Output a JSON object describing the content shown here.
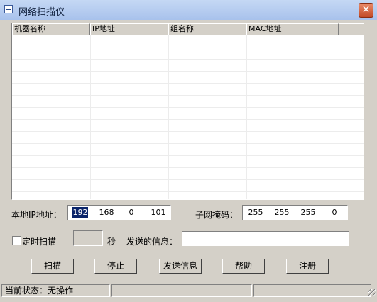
{
  "window": {
    "title": "网络扫描仪",
    "close_glyph": "✕"
  },
  "list": {
    "columns": [
      "机器名称",
      "IP地址",
      "组名称",
      "MAC地址"
    ]
  },
  "local_ip": {
    "label": "本地IP地址：",
    "octets": [
      "192",
      "168",
      "0",
      "101"
    ]
  },
  "subnet": {
    "label": "子网掩码：",
    "octets": [
      "255",
      "255",
      "255",
      "0"
    ]
  },
  "timer": {
    "label": "定时扫描",
    "unit": "秒",
    "value": ""
  },
  "message": {
    "label": "发送的信息：",
    "value": ""
  },
  "buttons": {
    "scan": "扫描",
    "stop": "停止",
    "send": "发送信息",
    "help": "帮助",
    "register": "注册"
  },
  "status": {
    "text": "当前状态：无操作",
    "pane2": "",
    "pane3": ""
  },
  "colors": {
    "titlebar": "#b8cdf0",
    "close": "#d0603c",
    "face": "#d4d0c8",
    "selection": "#0a246a"
  }
}
